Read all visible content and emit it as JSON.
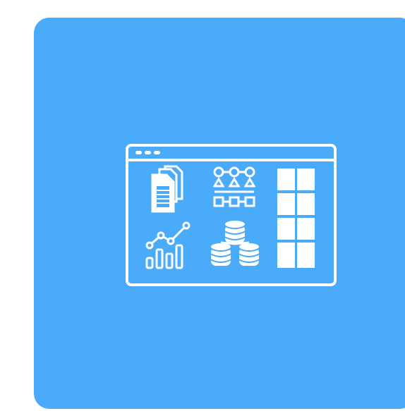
{
  "colors": {
    "background": "#ffffff",
    "card": "#4aabfa",
    "icon_stroke": "#ffffff"
  },
  "illustration": {
    "window": {
      "name": "app-window",
      "title_bar_dots": 3
    },
    "icons": [
      "documents-icon",
      "workflow-diagram-icon",
      "grid-table-icon",
      "line-bar-chart-icon",
      "database-stack-icon"
    ],
    "table": {
      "rows": 4,
      "columns": 2
    }
  }
}
